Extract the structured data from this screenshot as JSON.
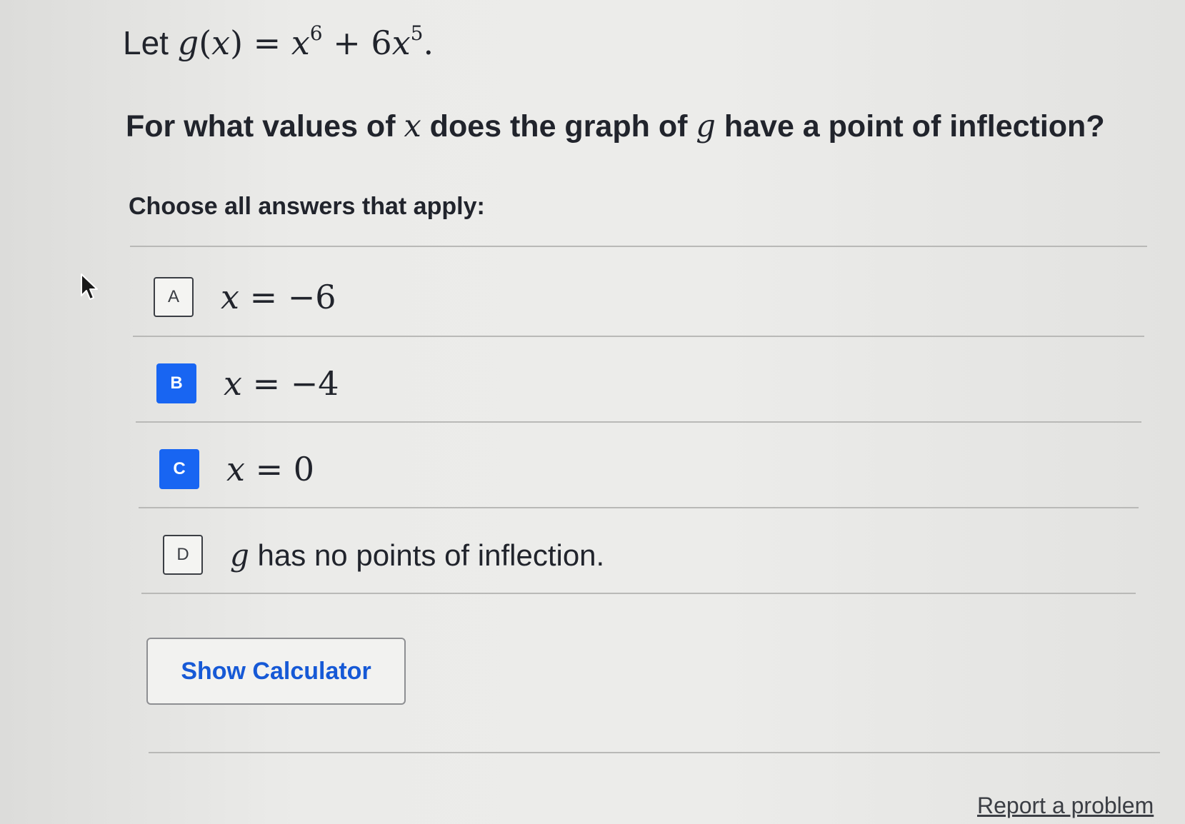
{
  "prompt": {
    "lead": "Let",
    "fn": "g",
    "open_paren": "(",
    "var": "x",
    "close_paren": ")",
    "equals": "=",
    "term1_base": "x",
    "term1_exp": "6",
    "plus": "+",
    "term2_coef": "6",
    "term2_base": "x",
    "term2_exp": "5",
    "period": "."
  },
  "question": {
    "part1": "For what values of ",
    "var_x": "x",
    "part2": " does the graph of ",
    "var_g": "g",
    "part3": " have a point of inflection?"
  },
  "instruction": "Choose all answers that apply:",
  "choices": [
    {
      "letter": "A",
      "var": "x",
      "rel": "=",
      "value": "−6",
      "selected": false
    },
    {
      "letter": "B",
      "var": "x",
      "rel": "=",
      "value": "−4",
      "selected": true
    },
    {
      "letter": "C",
      "var": "x",
      "rel": "=",
      "value": "0",
      "selected": true
    },
    {
      "letter": "D",
      "var": "g",
      "text": " has no points of inflection.",
      "selected": false
    }
  ],
  "buttons": {
    "show_calculator": "Show Calculator"
  },
  "footer": {
    "report_link": "Report a problem"
  },
  "colors": {
    "selected_accent": "#1865f2",
    "link_blue": "#1659d6",
    "background": "#e8e8e6"
  }
}
